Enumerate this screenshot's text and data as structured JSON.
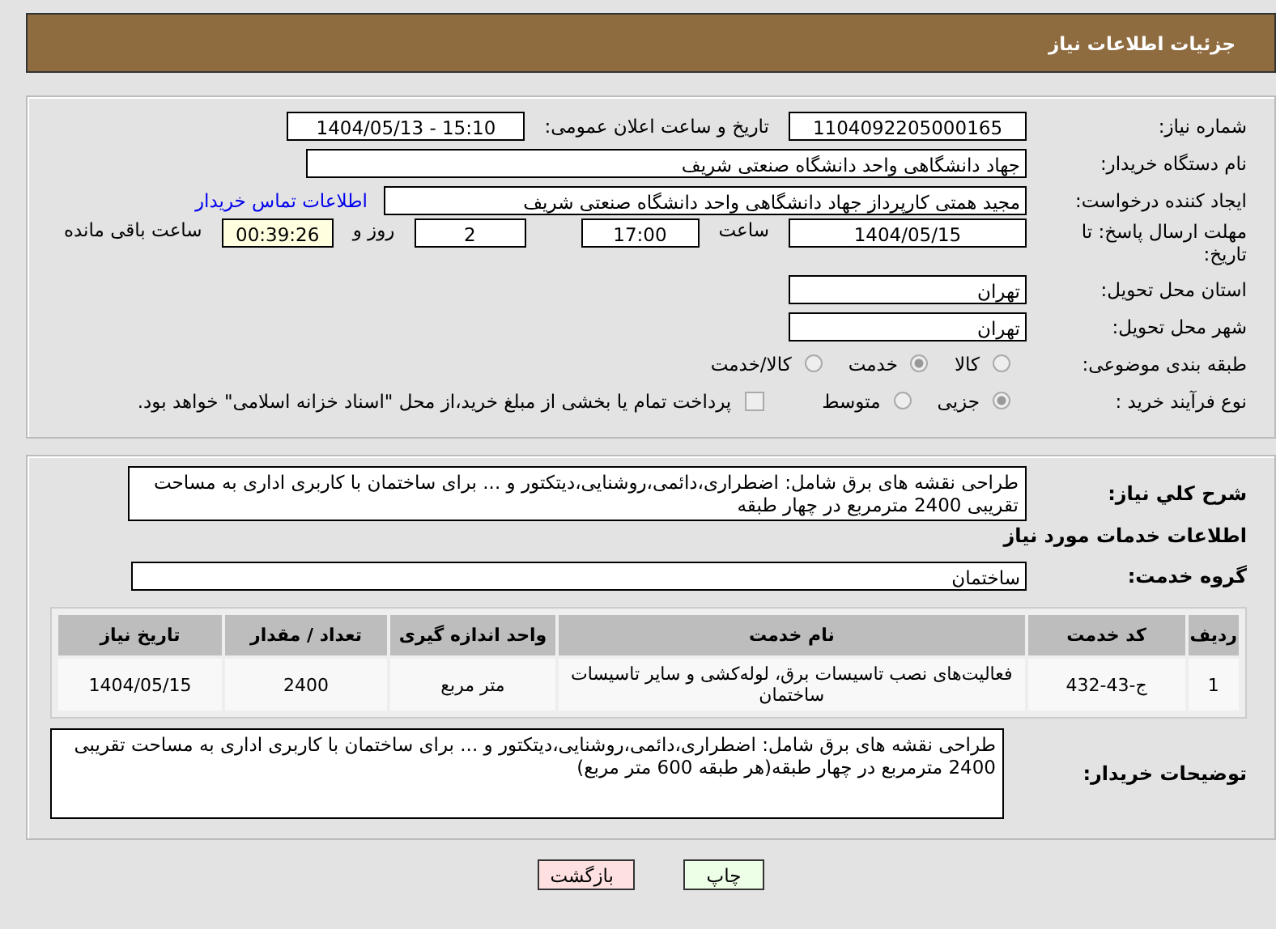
{
  "header": {
    "title": "جزئیات اطلاعات نیاز"
  },
  "need_number": {
    "label": "شماره نیاز:",
    "value": "1104092205000165"
  },
  "announce": {
    "label": "تاریخ و ساعت اعلان عمومی:",
    "value": "1404/05/13 - 15:10"
  },
  "buyer_org": {
    "label": "نام دستگاه خریدار:",
    "value": "جهاد دانشگاهی واحد دانشگاه صنعتی شریف"
  },
  "creator": {
    "label": "ایجاد کننده درخواست:",
    "value": "مجید همتی کارپرداز جهاد دانشگاهی واحد دانشگاه صنعتی شریف",
    "link": "اطلاعات تماس خریدار"
  },
  "deadline": {
    "label": "مهلت ارسال پاسخ: تا تاریخ:",
    "date": "1404/05/15",
    "time_label": "ساعت",
    "time": "17:00",
    "days": "2",
    "days_label": "روز و",
    "remaining": "00:39:26",
    "remaining_label": "ساعت باقی مانده"
  },
  "province": {
    "label": "استان محل تحویل:",
    "value": "تهران"
  },
  "city": {
    "label": "شهر محل تحویل:",
    "value": "تهران"
  },
  "category": {
    "label": "طبقه بندی موضوعی:",
    "options": [
      {
        "label": "کالا",
        "selected": false
      },
      {
        "label": "خدمت",
        "selected": true
      },
      {
        "label": "کالا/خدمت",
        "selected": false
      }
    ]
  },
  "process": {
    "label": "نوع فرآیند خرید :",
    "options": [
      {
        "label": "جزیی",
        "selected": true
      },
      {
        "label": "متوسط",
        "selected": false
      }
    ],
    "payment": {
      "label": "پرداخت تمام یا بخشی از مبلغ خرید،از محل \"اسناد خزانه اسلامی\" خواهد بود.",
      "checked": false
    }
  },
  "description": {
    "label": "شرح کلي نياز:",
    "value": "طراحی نقشه های برق شامل: اضطراری،دائمی،روشنایی،دیتکتور و ... برای ساختمان با کاربری اداری به مساحت تقریبی 2400 مترمربع در چهار طبقه"
  },
  "services_heading": "اطلاعات خدمات مورد نیاز",
  "service_group": {
    "label": "گروه خدمت:",
    "value": "ساختمان"
  },
  "table": {
    "columns": [
      "ردیف",
      "کد خدمت",
      "نام خدمت",
      "واحد اندازه گیری",
      "تعداد / مقدار",
      "تاریخ نیاز"
    ],
    "rows": [
      [
        "1",
        "ج-43-432",
        "فعالیت‌های نصب تاسیسات برق، لوله‌کشی و سایر تاسیسات ساختمان",
        "متر مربع",
        "2400",
        "1404/05/15"
      ]
    ]
  },
  "buyer_notes": {
    "label": "توضیحات خریدار:",
    "value": "طراحی نقشه های برق شامل: اضطراری،دائمی،روشنایی،دیتکتور و ... برای ساختمان با کاربری اداری به مساحت تقریبی 2400 مترمربع در چهار طبقه(هر طبقه 600 متر مربع)"
  },
  "buttons": [
    {
      "label": "چاپ",
      "kind": "print"
    },
    {
      "label": "بازگشت",
      "kind": "back"
    }
  ]
}
